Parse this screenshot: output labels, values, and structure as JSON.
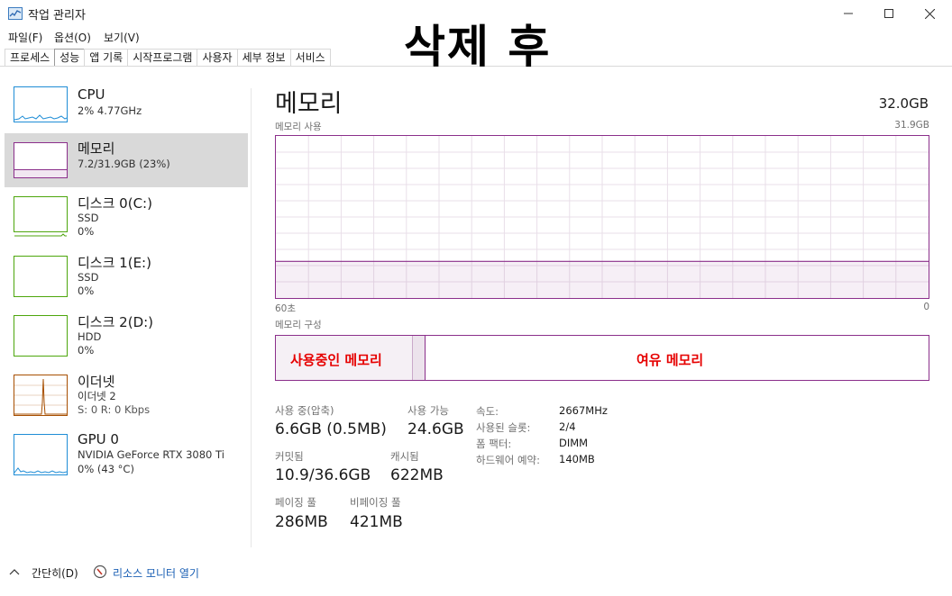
{
  "window": {
    "title": "작업 관리자"
  },
  "overlay_text": "삭제 후",
  "menu": [
    {
      "label": "파일(F)"
    },
    {
      "label": "옵션(O)"
    },
    {
      "label": "보기(V)"
    }
  ],
  "tabs": [
    {
      "label": "프로세스"
    },
    {
      "label": "성능"
    },
    {
      "label": "앱 기록"
    },
    {
      "label": "시작프로그램"
    },
    {
      "label": "사용자"
    },
    {
      "label": "세부 정보"
    },
    {
      "label": "서비스"
    }
  ],
  "sidebar": {
    "items": [
      {
        "name": "CPU",
        "sub1": "2% 4.77GHz",
        "sub2": "",
        "color": "#1f8dd6"
      },
      {
        "name": "메모리",
        "sub1": "7.2/31.9GB (23%)",
        "sub2": "",
        "color": "#8b2f8b"
      },
      {
        "name": "디스크 0(C:)",
        "sub1": "SSD",
        "sub2": "0%",
        "color": "#4da60c"
      },
      {
        "name": "디스크 1(E:)",
        "sub1": "SSD",
        "sub2": "0%",
        "color": "#4da60c"
      },
      {
        "name": "디스크 2(D:)",
        "sub1": "HDD",
        "sub2": "0%",
        "color": "#4da60c"
      },
      {
        "name": "이더넷",
        "sub1": "이더넷 2",
        "sub2": "S: 0  R: 0 Kbps",
        "color": "#a74f01"
      },
      {
        "name": "GPU 0",
        "sub1": "NVIDIA GeForce RTX 3080 Ti",
        "sub2": "0% (43 °C)",
        "color": "#1f8dd6"
      }
    ]
  },
  "main": {
    "title": "메모리",
    "total": "32.0GB",
    "usage_label": "메모리 사용",
    "usage_max": "31.9GB",
    "x_left": "60초",
    "x_right": "0",
    "usage_fraction": 0.226,
    "composition_label": "메모리 구성",
    "in_use_label": "사용중인 메모리",
    "available_label": "여유 메모리"
  },
  "stats": {
    "in_use_label": "사용 중(압축)",
    "in_use_value": "6.6GB (0.5MB)",
    "available_label": "사용 가능",
    "available_value": "24.6GB",
    "committed_label": "커밋됨",
    "committed_value": "10.9/36.6GB",
    "cached_label": "캐시됨",
    "cached_value": "622MB",
    "paged_label": "페이징 풀",
    "paged_value": "286MB",
    "nonpaged_label": "비페이징 풀",
    "nonpaged_value": "421MB"
  },
  "specs": [
    {
      "label": "속도:",
      "value": "2667MHz"
    },
    {
      "label": "사용된 슬롯:",
      "value": "2/4"
    },
    {
      "label": "폼 팩터:",
      "value": "DIMM"
    },
    {
      "label": "하드웨어 예약:",
      "value": "140MB"
    }
  ],
  "footer": {
    "fewer_details": "간단히(D)",
    "resource_monitor": "리소스 모니터 열기"
  }
}
